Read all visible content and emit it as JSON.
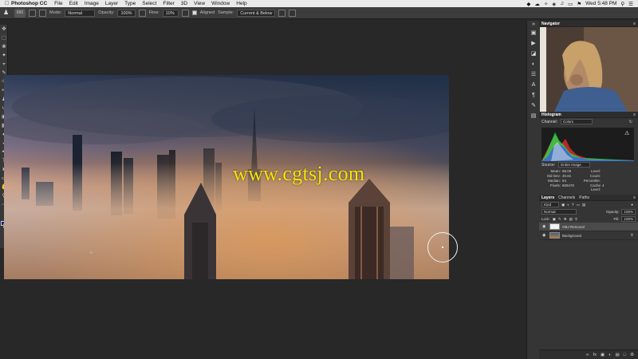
{
  "menubar": {
    "app": "Photoshop CC",
    "items": [
      "File",
      "Edit",
      "Image",
      "Layer",
      "Type",
      "Select",
      "Filter",
      "3D",
      "View",
      "Window",
      "Help"
    ],
    "clock": "Wed 5:48 PM"
  },
  "options": {
    "brush_size": "650",
    "mode_label": "Mode:",
    "mode_value": "Normal",
    "opacity_label": "Opacity:",
    "opacity_value": "100%",
    "flow_label": "Flow:",
    "flow_value": "10%",
    "aligned_label": "Aligned",
    "sample_label": "Sample:",
    "sample_value": "Current & Below"
  },
  "canvas": {
    "watermark": "www.cgtsj.com"
  },
  "navigator": {
    "title": "Navigator"
  },
  "histogram": {
    "title": "Histogram",
    "channel_label": "Channel:",
    "channel_value": "Colors",
    "source_label": "Source:",
    "source_value": "Entire Image",
    "stats": {
      "mean_label": "Mean:",
      "mean": "88.05",
      "stddev_label": "Std Dev:",
      "stddev": "30.81",
      "median_label": "Median:",
      "median": "84",
      "pixels_label": "Pixels:",
      "pixels": "809470",
      "level_label": "Level:",
      "count_label": "Count:",
      "percentile_label": "Percentile:",
      "cache_label": "Cache Level:",
      "cache": "4"
    }
  },
  "layers": {
    "tabs": [
      "Layers",
      "Channels",
      "Paths"
    ],
    "kind_label": "Kind",
    "blend": "Normal",
    "opacity_label": "Opacity:",
    "opacity": "100%",
    "lock_label": "Lock:",
    "fill_label": "Fill:",
    "fill": "100%",
    "items": [
      {
        "name": "OBJ Removal"
      },
      {
        "name": "Background"
      }
    ]
  }
}
